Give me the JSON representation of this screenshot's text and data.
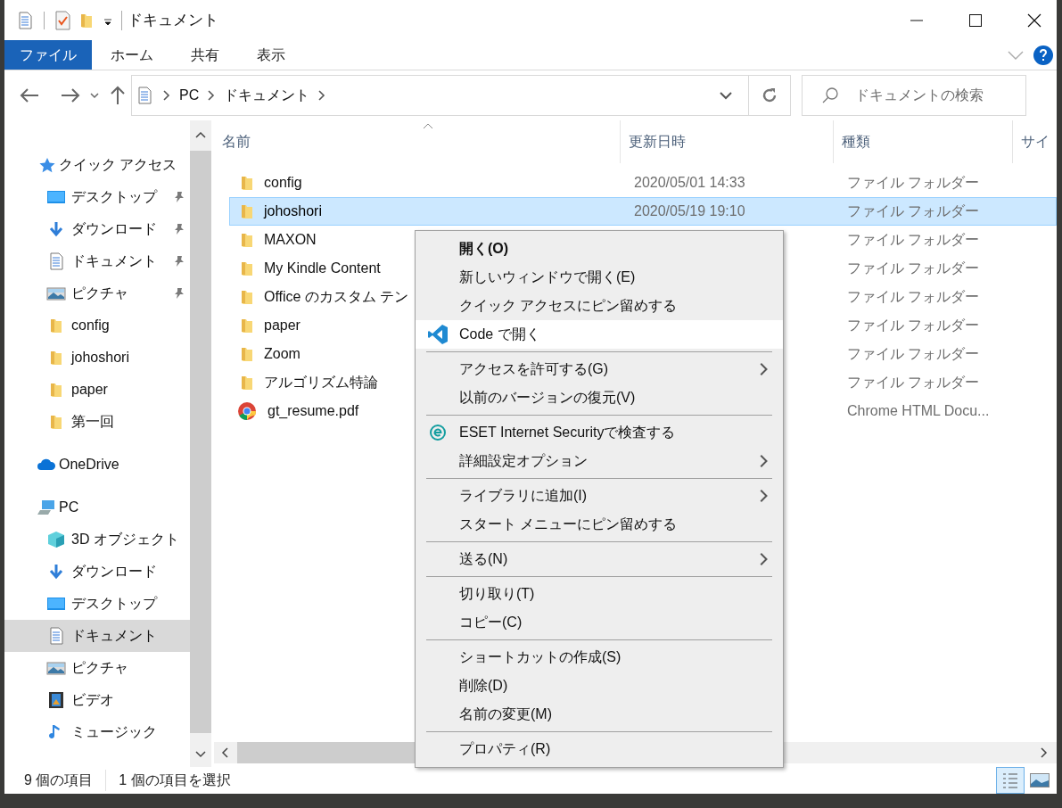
{
  "window": {
    "title": "ドキュメント"
  },
  "ribbon": {
    "tabs": [
      {
        "label": "ファイル",
        "selected": true
      },
      {
        "label": "ホーム",
        "selected": false
      },
      {
        "label": "共有",
        "selected": false
      },
      {
        "label": "表示",
        "selected": false
      }
    ]
  },
  "address": {
    "path": [
      "PC",
      "ドキュメント"
    ],
    "search_placeholder": "ドキュメントの検索"
  },
  "navigation": [
    {
      "label": "クイック アクセス",
      "kind": "star",
      "selected": false,
      "children": [
        {
          "label": "デスクトップ",
          "kind": "desktop",
          "pinned": true,
          "selected": false
        },
        {
          "label": "ダウンロード",
          "kind": "download",
          "pinned": true,
          "selected": false
        },
        {
          "label": "ドキュメント",
          "kind": "document",
          "pinned": true,
          "selected": false
        },
        {
          "label": "ピクチャ",
          "kind": "picture",
          "pinned": true,
          "selected": false
        },
        {
          "label": "config",
          "kind": "folder",
          "pinned": false,
          "selected": false
        },
        {
          "label": "johoshori",
          "kind": "folder",
          "pinned": false,
          "selected": false
        },
        {
          "label": "paper",
          "kind": "folder",
          "pinned": false,
          "selected": false
        },
        {
          "label": "第一回",
          "kind": "folder",
          "pinned": false,
          "selected": false
        }
      ]
    },
    {
      "label": "OneDrive",
      "kind": "cloud",
      "selected": false
    },
    {
      "label": "PC",
      "kind": "pc",
      "selected": false,
      "children": [
        {
          "label": "3D オブジェクト",
          "kind": "cube",
          "pinned": false,
          "selected": false
        },
        {
          "label": "ダウンロード",
          "kind": "download",
          "pinned": false,
          "selected": false
        },
        {
          "label": "デスクトップ",
          "kind": "desktop",
          "pinned": false,
          "selected": false
        },
        {
          "label": "ドキュメント",
          "kind": "document",
          "pinned": false,
          "selected": true
        },
        {
          "label": "ピクチャ",
          "kind": "picture",
          "pinned": false,
          "selected": false
        },
        {
          "label": "ビデオ",
          "kind": "video",
          "pinned": false,
          "selected": false
        },
        {
          "label": "ミュージック",
          "kind": "music",
          "pinned": false,
          "selected": false
        }
      ]
    }
  ],
  "table": {
    "columns": [
      "名前",
      "更新日時",
      "種類",
      "サイ"
    ],
    "rows": [
      {
        "name": "config",
        "date": "2020/05/01 14:33",
        "type": "ファイル フォルダー",
        "kind": "folder",
        "selected": false
      },
      {
        "name": "johoshori",
        "date": "2020/05/19 19:10",
        "type": "ファイル フォルダー",
        "kind": "folder",
        "selected": true
      },
      {
        "name": "MAXON",
        "type": "ファイル フォルダー",
        "kind": "folder",
        "selected": false
      },
      {
        "name": "My Kindle Content",
        "type": "ファイル フォルダー",
        "kind": "folder",
        "selected": false
      },
      {
        "name": "Office のカスタム テン",
        "type": "ファイル フォルダー",
        "kind": "folder",
        "selected": false
      },
      {
        "name": "paper",
        "type": "ファイル フォルダー",
        "kind": "folder",
        "selected": false
      },
      {
        "name": "Zoom",
        "type": "ファイル フォルダー",
        "kind": "folder",
        "selected": false
      },
      {
        "name": "アルゴリズム特論",
        "type": "ファイル フォルダー",
        "kind": "folder",
        "selected": false
      },
      {
        "name": "gt_resume.pdf",
        "type": "Chrome HTML Docu...",
        "kind": "chrome",
        "selected": false
      }
    ]
  },
  "status_bar": {
    "count": "9 個の項目",
    "selection": "1 個の項目を選択"
  },
  "context_menu": {
    "groups": [
      [
        {
          "label": "開く(O)",
          "bold": true,
          "submenu": false,
          "selected": false
        },
        {
          "label": "新しいウィンドウで開く(E)",
          "bold": false,
          "submenu": false,
          "selected": false
        },
        {
          "label": "クイック アクセスにピン留めする",
          "bold": false,
          "submenu": false,
          "selected": false
        },
        {
          "label": "Code で開く",
          "kind": "code",
          "bold": false,
          "submenu": false,
          "selected": true
        }
      ],
      [
        {
          "label": "アクセスを許可する(G)",
          "bold": false,
          "submenu": true,
          "selected": false
        },
        {
          "label": "以前のバージョンの復元(V)",
          "bold": false,
          "submenu": false,
          "selected": false
        }
      ],
      [
        {
          "label": "ESET Internet Securityで検査する",
          "kind": "eset",
          "bold": false,
          "submenu": false,
          "selected": false
        },
        {
          "label": "詳細設定オプション",
          "bold": false,
          "submenu": true,
          "selected": false
        }
      ],
      [
        {
          "label": "ライブラリに追加(I)",
          "bold": false,
          "submenu": true,
          "selected": false
        },
        {
          "label": "スタート メニューにピン留めする",
          "bold": false,
          "submenu": false,
          "selected": false
        }
      ],
      [
        {
          "label": "送る(N)",
          "bold": false,
          "submenu": true,
          "selected": false
        }
      ],
      [
        {
          "label": "切り取り(T)",
          "bold": false,
          "submenu": false,
          "selected": false
        },
        {
          "label": "コピー(C)",
          "bold": false,
          "submenu": false,
          "selected": false
        }
      ],
      [
        {
          "label": "ショートカットの作成(S)",
          "bold": false,
          "submenu": false,
          "selected": false
        },
        {
          "label": "削除(D)",
          "bold": false,
          "submenu": false,
          "selected": false
        },
        {
          "label": "名前の変更(M)",
          "bold": false,
          "submenu": false,
          "selected": false
        }
      ],
      [
        {
          "label": "プロパティ(R)",
          "bold": false,
          "submenu": false,
          "selected": false
        }
      ]
    ]
  }
}
